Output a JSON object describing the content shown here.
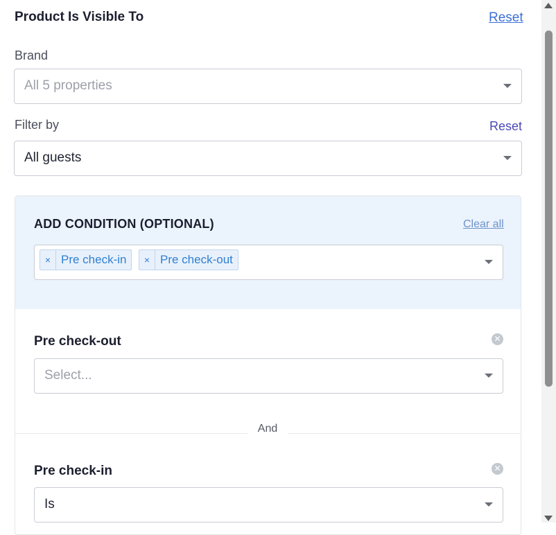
{
  "header": {
    "title": "Product Is Visible To",
    "reset_label": "Reset"
  },
  "brand": {
    "label": "Brand",
    "placeholder": "All 5 properties"
  },
  "filter": {
    "label": "Filter by",
    "reset_label": "Reset",
    "value": "All guests"
  },
  "conditions": {
    "title": "ADD CONDITION (OPTIONAL)",
    "clear_all_label": "Clear all",
    "chips": [
      {
        "remove": "×",
        "label": "Pre check-in"
      },
      {
        "remove": "×",
        "label": "Pre check-out"
      }
    ],
    "items": [
      {
        "label": "Pre check-out",
        "placeholder": "Select...",
        "value": ""
      },
      {
        "label": "Pre check-in",
        "placeholder": "",
        "value": "Is"
      }
    ],
    "joiner": "And"
  },
  "colors": {
    "accent": "#3d6fd6",
    "panel_bg": "#ebf3fd",
    "chip_text": "#2f7fd0"
  }
}
